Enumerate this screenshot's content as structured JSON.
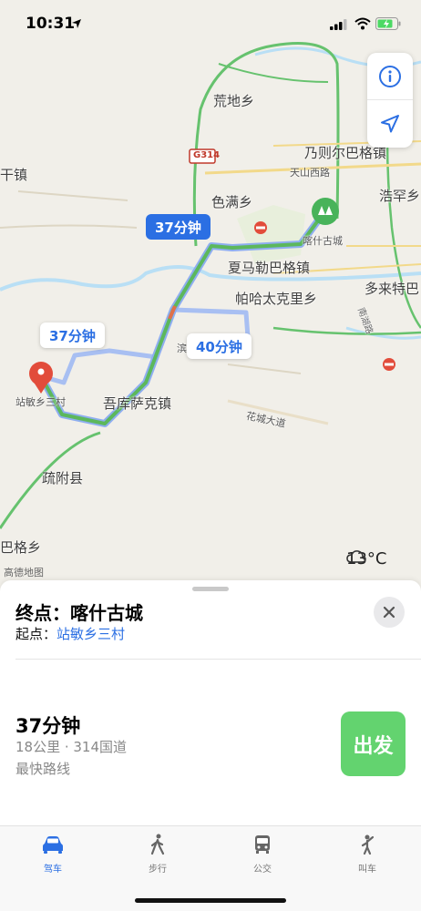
{
  "status": {
    "time": "10:31"
  },
  "map": {
    "labels": {
      "huangdi": "荒地乡",
      "naizer": "乃则尔巴格镇",
      "ganzhen": "干镇",
      "tianshan_road": "天山西路",
      "haohan": "浩罕乡",
      "semanxiang": "色满乡",
      "kashgar": "喀什古城",
      "xiamale": "夏马勒巴格镇",
      "duolai": "多来特巴",
      "pahatai": "帕哈太克里乡",
      "nanhu": "南湖路",
      "binhe": "滨",
      "zhanmin": "站敏乡三村",
      "wukusak": "吾库萨克镇",
      "huacheng": "花城大道",
      "shufu": "疏附县",
      "bagexiang": "巴格乡",
      "g314": "G314"
    },
    "provider": "高德地图",
    "weather": "13°C"
  },
  "routes": {
    "selected_time": "37分钟",
    "alt1_time": "37分钟",
    "alt2_time": "40分钟"
  },
  "sheet": {
    "destination": "终点：喀什古城",
    "origin_prefix": "起点：",
    "origin_name": "站敏乡三村",
    "duration": "37分钟",
    "details": "18公里 · 314国道",
    "note": "最快路线",
    "go_label": "出发"
  },
  "tabs": [
    {
      "label": "驾车",
      "icon": "car-icon",
      "active": true
    },
    {
      "label": "步行",
      "icon": "walk-icon",
      "active": false
    },
    {
      "label": "公交",
      "icon": "bus-icon",
      "active": false
    },
    {
      "label": "叫车",
      "icon": "taxi-icon",
      "active": false
    }
  ],
  "colors": {
    "accent": "#2b6fe3",
    "route": "#5cb85c",
    "go": "#63d36f",
    "pin": "#e24c3b",
    "poi": "#48b35a"
  }
}
